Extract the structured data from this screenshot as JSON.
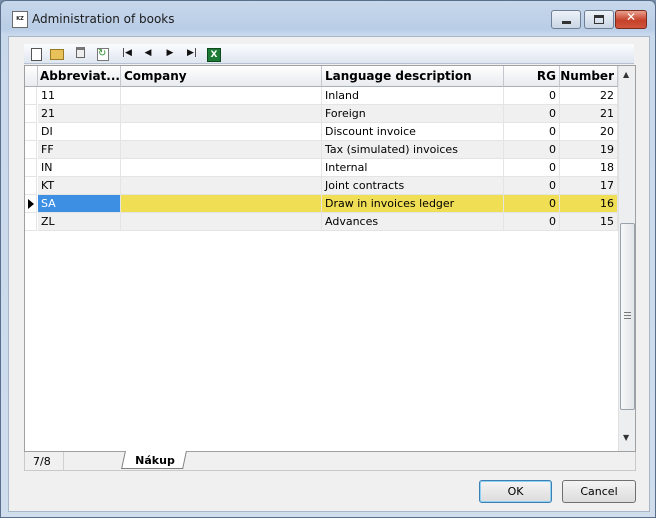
{
  "window": {
    "title": "Administration of books",
    "app_icon_text": "KZ"
  },
  "toolbar": {
    "items": [
      {
        "icon": "new-document-icon"
      },
      {
        "icon": "open-folder-icon"
      },
      {
        "icon": "delete-icon"
      },
      {
        "icon": "refresh-icon"
      },
      {
        "icon": "first-record-icon"
      },
      {
        "icon": "previous-record-icon"
      },
      {
        "icon": "next-record-icon"
      },
      {
        "icon": "last-record-icon"
      },
      {
        "icon": "export-excel-icon"
      }
    ]
  },
  "grid": {
    "columns": [
      "Abbreviat...",
      "Company",
      "Language description",
      "RG",
      "Number"
    ],
    "rows": [
      {
        "abbr": "11",
        "company": "",
        "desc": "Inland",
        "rg": "0",
        "number": "22"
      },
      {
        "abbr": "21",
        "company": "",
        "desc": "Foreign",
        "rg": "0",
        "number": "21"
      },
      {
        "abbr": "DI",
        "company": "",
        "desc": "Discount invoice",
        "rg": "0",
        "number": "20"
      },
      {
        "abbr": "FF",
        "company": "",
        "desc": "Tax (simulated) invoices",
        "rg": "0",
        "number": "19"
      },
      {
        "abbr": "IN",
        "company": "",
        "desc": "Internal",
        "rg": "0",
        "number": "18"
      },
      {
        "abbr": "KT",
        "company": "",
        "desc": "Joint contracts",
        "rg": "0",
        "number": "17"
      },
      {
        "abbr": "SA",
        "company": "",
        "desc": "Draw in invoices ledger",
        "rg": "0",
        "number": "16"
      },
      {
        "abbr": "ZL",
        "company": "",
        "desc": "Advances",
        "rg": "0",
        "number": "15"
      }
    ],
    "selected_index": 6
  },
  "status": {
    "record_counter": "7/8",
    "tab_label": "Nákup"
  },
  "buttons": {
    "ok": "OK",
    "cancel": "Cancel"
  },
  "colors": {
    "selected_row": "#f0de55",
    "selected_cell": "#3c8fe3"
  }
}
